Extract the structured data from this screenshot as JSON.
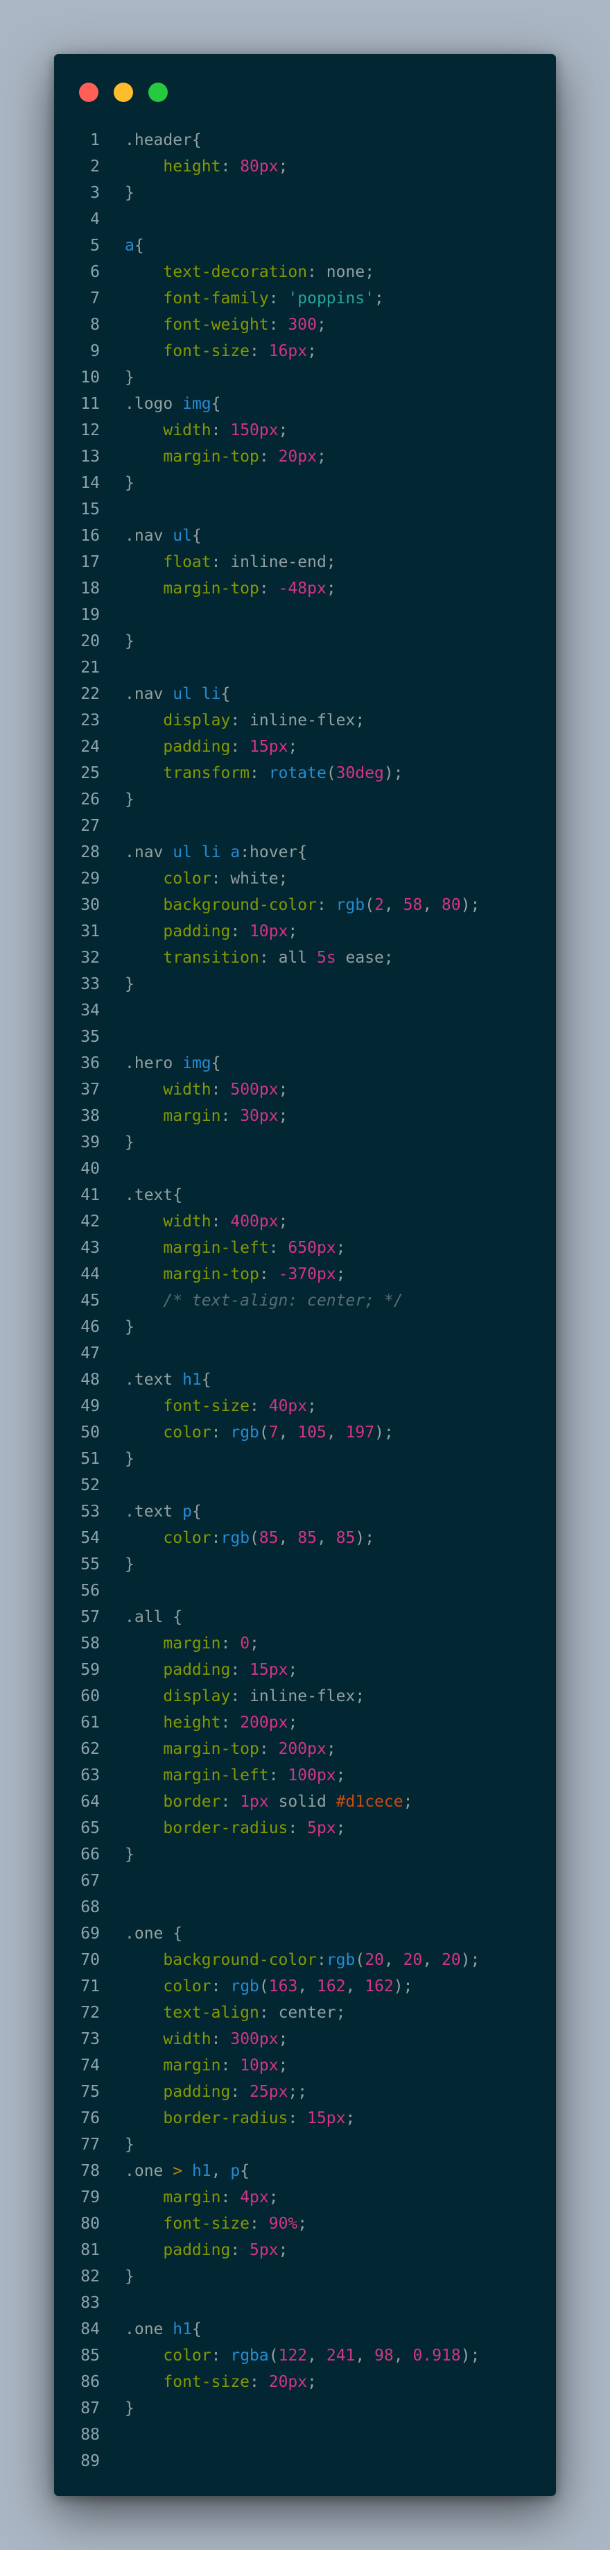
{
  "window": {
    "buttons": [
      "close",
      "minimize",
      "maximize"
    ]
  },
  "colors": {
    "page_background": "#aab6c3",
    "editor_background": "#022632",
    "close": "#ff5f56",
    "minimize": "#ffbd2e",
    "maximize": "#27c93f"
  },
  "lines": [
    [
      [
        "sel",
        ".header{"
      ]
    ],
    [
      [
        "plain",
        "    "
      ],
      [
        "prop",
        "height"
      ],
      [
        "plain",
        ": "
      ],
      [
        "num",
        "80px"
      ],
      [
        "plain",
        ";"
      ]
    ],
    [
      [
        "sel",
        "}"
      ]
    ],
    [],
    [
      [
        "tag",
        "a"
      ],
      [
        "sel",
        "{"
      ]
    ],
    [
      [
        "plain",
        "    "
      ],
      [
        "prop",
        "text-decoration"
      ],
      [
        "plain",
        ": none;"
      ]
    ],
    [
      [
        "plain",
        "    "
      ],
      [
        "prop",
        "font-family"
      ],
      [
        "plain",
        ": "
      ],
      [
        "str",
        "'poppins'"
      ],
      [
        "plain",
        ";"
      ]
    ],
    [
      [
        "plain",
        "    "
      ],
      [
        "prop",
        "font-weight"
      ],
      [
        "plain",
        ": "
      ],
      [
        "num",
        "300"
      ],
      [
        "plain",
        ";"
      ]
    ],
    [
      [
        "plain",
        "    "
      ],
      [
        "prop",
        "font-size"
      ],
      [
        "plain",
        ": "
      ],
      [
        "num",
        "16px"
      ],
      [
        "plain",
        ";"
      ]
    ],
    [
      [
        "sel",
        "}"
      ]
    ],
    [
      [
        "sel",
        ".logo "
      ],
      [
        "tag",
        "img"
      ],
      [
        "sel",
        "{"
      ]
    ],
    [
      [
        "plain",
        "    "
      ],
      [
        "prop",
        "width"
      ],
      [
        "plain",
        ": "
      ],
      [
        "num",
        "150px"
      ],
      [
        "plain",
        ";"
      ]
    ],
    [
      [
        "plain",
        "    "
      ],
      [
        "prop",
        "margin-top"
      ],
      [
        "plain",
        ": "
      ],
      [
        "num",
        "20px"
      ],
      [
        "plain",
        ";"
      ]
    ],
    [
      [
        "sel",
        "}"
      ]
    ],
    [],
    [
      [
        "sel",
        ".nav "
      ],
      [
        "tag",
        "ul"
      ],
      [
        "sel",
        "{"
      ]
    ],
    [
      [
        "plain",
        "    "
      ],
      [
        "prop",
        "float"
      ],
      [
        "plain",
        ": inline-end;"
      ]
    ],
    [
      [
        "plain",
        "    "
      ],
      [
        "prop",
        "margin-top"
      ],
      [
        "plain",
        ": "
      ],
      [
        "num",
        "-48px"
      ],
      [
        "plain",
        ";"
      ]
    ],
    [],
    [
      [
        "sel",
        "}"
      ]
    ],
    [],
    [
      [
        "sel",
        ".nav "
      ],
      [
        "tag",
        "ul li"
      ],
      [
        "sel",
        "{"
      ]
    ],
    [
      [
        "plain",
        "    "
      ],
      [
        "prop",
        "display"
      ],
      [
        "plain",
        ": inline-flex;"
      ]
    ],
    [
      [
        "plain",
        "    "
      ],
      [
        "prop",
        "padding"
      ],
      [
        "plain",
        ": "
      ],
      [
        "num",
        "15px"
      ],
      [
        "plain",
        ";"
      ]
    ],
    [
      [
        "plain",
        "    "
      ],
      [
        "prop",
        "transform"
      ],
      [
        "plain",
        ": "
      ],
      [
        "fn",
        "rotate"
      ],
      [
        "plain",
        "("
      ],
      [
        "num",
        "30deg"
      ],
      [
        "plain",
        ");"
      ]
    ],
    [
      [
        "sel",
        "}"
      ]
    ],
    [],
    [
      [
        "sel",
        ".nav "
      ],
      [
        "tag",
        "ul li a"
      ],
      [
        "sel",
        ":hover{"
      ]
    ],
    [
      [
        "plain",
        "    "
      ],
      [
        "prop",
        "color"
      ],
      [
        "plain",
        ": white;"
      ]
    ],
    [
      [
        "plain",
        "    "
      ],
      [
        "prop",
        "background-color"
      ],
      [
        "plain",
        ": "
      ],
      [
        "fn",
        "rgb"
      ],
      [
        "plain",
        "("
      ],
      [
        "num",
        "2"
      ],
      [
        "plain",
        ", "
      ],
      [
        "num",
        "58"
      ],
      [
        "plain",
        ", "
      ],
      [
        "num",
        "80"
      ],
      [
        "plain",
        ");"
      ]
    ],
    [
      [
        "plain",
        "    "
      ],
      [
        "prop",
        "padding"
      ],
      [
        "plain",
        ": "
      ],
      [
        "num",
        "10px"
      ],
      [
        "plain",
        ";"
      ]
    ],
    [
      [
        "plain",
        "    "
      ],
      [
        "prop",
        "transition"
      ],
      [
        "plain",
        ": all "
      ],
      [
        "num",
        "5s"
      ],
      [
        "plain",
        " ease;"
      ]
    ],
    [
      [
        "sel",
        "}"
      ]
    ],
    [],
    [],
    [
      [
        "sel",
        ".hero "
      ],
      [
        "tag",
        "img"
      ],
      [
        "sel",
        "{"
      ]
    ],
    [
      [
        "plain",
        "    "
      ],
      [
        "prop",
        "width"
      ],
      [
        "plain",
        ": "
      ],
      [
        "num",
        "500px"
      ],
      [
        "plain",
        ";"
      ]
    ],
    [
      [
        "plain",
        "    "
      ],
      [
        "prop",
        "margin"
      ],
      [
        "plain",
        ": "
      ],
      [
        "num",
        "30px"
      ],
      [
        "plain",
        ";"
      ]
    ],
    [
      [
        "sel",
        "}"
      ]
    ],
    [],
    [
      [
        "sel",
        ".text{"
      ]
    ],
    [
      [
        "plain",
        "    "
      ],
      [
        "prop",
        "width"
      ],
      [
        "plain",
        ": "
      ],
      [
        "num",
        "400px"
      ],
      [
        "plain",
        ";"
      ]
    ],
    [
      [
        "plain",
        "    "
      ],
      [
        "prop",
        "margin-left"
      ],
      [
        "plain",
        ": "
      ],
      [
        "num",
        "650px"
      ],
      [
        "plain",
        ";"
      ]
    ],
    [
      [
        "plain",
        "    "
      ],
      [
        "prop",
        "margin-top"
      ],
      [
        "plain",
        ": "
      ],
      [
        "num",
        "-370px"
      ],
      [
        "plain",
        ";"
      ]
    ],
    [
      [
        "plain",
        "    "
      ],
      [
        "cmt",
        "/* text-align: center; */"
      ]
    ],
    [
      [
        "sel",
        "}"
      ]
    ],
    [],
    [
      [
        "sel",
        ".text "
      ],
      [
        "tag",
        "h1"
      ],
      [
        "sel",
        "{"
      ]
    ],
    [
      [
        "plain",
        "    "
      ],
      [
        "prop",
        "font-size"
      ],
      [
        "plain",
        ": "
      ],
      [
        "num",
        "40px"
      ],
      [
        "plain",
        ";"
      ]
    ],
    [
      [
        "plain",
        "    "
      ],
      [
        "prop",
        "color"
      ],
      [
        "plain",
        ": "
      ],
      [
        "fn",
        "rgb"
      ],
      [
        "plain",
        "("
      ],
      [
        "num",
        "7"
      ],
      [
        "plain",
        ", "
      ],
      [
        "num",
        "105"
      ],
      [
        "plain",
        ", "
      ],
      [
        "num",
        "197"
      ],
      [
        "plain",
        ");"
      ]
    ],
    [
      [
        "sel",
        "}"
      ]
    ],
    [],
    [
      [
        "sel",
        ".text "
      ],
      [
        "tag",
        "p"
      ],
      [
        "sel",
        "{"
      ]
    ],
    [
      [
        "plain",
        "    "
      ],
      [
        "prop",
        "color"
      ],
      [
        "plain",
        ":"
      ],
      [
        "fn",
        "rgb"
      ],
      [
        "plain",
        "("
      ],
      [
        "num",
        "85"
      ],
      [
        "plain",
        ", "
      ],
      [
        "num",
        "85"
      ],
      [
        "plain",
        ", "
      ],
      [
        "num",
        "85"
      ],
      [
        "plain",
        ");"
      ]
    ],
    [
      [
        "sel",
        "}"
      ]
    ],
    [],
    [
      [
        "sel",
        ".all {"
      ]
    ],
    [
      [
        "plain",
        "    "
      ],
      [
        "prop",
        "margin"
      ],
      [
        "plain",
        ": "
      ],
      [
        "num",
        "0"
      ],
      [
        "plain",
        ";"
      ]
    ],
    [
      [
        "plain",
        "    "
      ],
      [
        "prop",
        "padding"
      ],
      [
        "plain",
        ": "
      ],
      [
        "num",
        "15px"
      ],
      [
        "plain",
        ";"
      ]
    ],
    [
      [
        "plain",
        "    "
      ],
      [
        "prop",
        "display"
      ],
      [
        "plain",
        ": inline-flex;"
      ]
    ],
    [
      [
        "plain",
        "    "
      ],
      [
        "prop",
        "height"
      ],
      [
        "plain",
        ": "
      ],
      [
        "num",
        "200px"
      ],
      [
        "plain",
        ";"
      ]
    ],
    [
      [
        "plain",
        "    "
      ],
      [
        "prop",
        "margin-top"
      ],
      [
        "plain",
        ": "
      ],
      [
        "num",
        "200px"
      ],
      [
        "plain",
        ";"
      ]
    ],
    [
      [
        "plain",
        "    "
      ],
      [
        "prop",
        "margin-left"
      ],
      [
        "plain",
        ": "
      ],
      [
        "num",
        "100px"
      ],
      [
        "plain",
        ";"
      ]
    ],
    [
      [
        "plain",
        "    "
      ],
      [
        "prop",
        "border"
      ],
      [
        "plain",
        ": "
      ],
      [
        "num",
        "1px"
      ],
      [
        "plain",
        " solid "
      ],
      [
        "hex",
        "#d1cece"
      ],
      [
        "plain",
        ";"
      ]
    ],
    [
      [
        "plain",
        "    "
      ],
      [
        "prop",
        "border-radius"
      ],
      [
        "plain",
        ": "
      ],
      [
        "num",
        "5px"
      ],
      [
        "plain",
        ";"
      ]
    ],
    [
      [
        "sel",
        "}"
      ]
    ],
    [],
    [],
    [
      [
        "sel",
        ".one {"
      ]
    ],
    [
      [
        "plain",
        "    "
      ],
      [
        "prop",
        "background-color"
      ],
      [
        "plain",
        ":"
      ],
      [
        "fn",
        "rgb"
      ],
      [
        "plain",
        "("
      ],
      [
        "num",
        "20"
      ],
      [
        "plain",
        ", "
      ],
      [
        "num",
        "20"
      ],
      [
        "plain",
        ", "
      ],
      [
        "num",
        "20"
      ],
      [
        "plain",
        ");"
      ]
    ],
    [
      [
        "plain",
        "    "
      ],
      [
        "prop",
        "color"
      ],
      [
        "plain",
        ": "
      ],
      [
        "fn",
        "rgb"
      ],
      [
        "plain",
        "("
      ],
      [
        "num",
        "163"
      ],
      [
        "plain",
        ", "
      ],
      [
        "num",
        "162"
      ],
      [
        "plain",
        ", "
      ],
      [
        "num",
        "162"
      ],
      [
        "plain",
        ");"
      ]
    ],
    [
      [
        "plain",
        "    "
      ],
      [
        "prop",
        "text-align"
      ],
      [
        "plain",
        ": center;"
      ]
    ],
    [
      [
        "plain",
        "    "
      ],
      [
        "prop",
        "width"
      ],
      [
        "plain",
        ": "
      ],
      [
        "num",
        "300px"
      ],
      [
        "plain",
        ";"
      ]
    ],
    [
      [
        "plain",
        "    "
      ],
      [
        "prop",
        "margin"
      ],
      [
        "plain",
        ": "
      ],
      [
        "num",
        "10px"
      ],
      [
        "plain",
        ";"
      ]
    ],
    [
      [
        "plain",
        "    "
      ],
      [
        "prop",
        "padding"
      ],
      [
        "plain",
        ": "
      ],
      [
        "num",
        "25px"
      ],
      [
        "plain",
        ";;"
      ]
    ],
    [
      [
        "plain",
        "    "
      ],
      [
        "prop",
        "border-radius"
      ],
      [
        "plain",
        ": "
      ],
      [
        "num",
        "15px"
      ],
      [
        "plain",
        ";"
      ]
    ],
    [
      [
        "sel",
        "}"
      ]
    ],
    [
      [
        "sel",
        ".one "
      ],
      [
        "kw",
        ">"
      ],
      [
        "plain",
        " "
      ],
      [
        "tag",
        "h1"
      ],
      [
        "plain",
        ", "
      ],
      [
        "tag",
        "p"
      ],
      [
        "sel",
        "{"
      ]
    ],
    [
      [
        "plain",
        "    "
      ],
      [
        "prop",
        "margin"
      ],
      [
        "plain",
        ": "
      ],
      [
        "num",
        "4px"
      ],
      [
        "plain",
        ";"
      ]
    ],
    [
      [
        "plain",
        "    "
      ],
      [
        "prop",
        "font-size"
      ],
      [
        "plain",
        ": "
      ],
      [
        "num",
        "90%"
      ],
      [
        "plain",
        ";"
      ]
    ],
    [
      [
        "plain",
        "    "
      ],
      [
        "prop",
        "padding"
      ],
      [
        "plain",
        ": "
      ],
      [
        "num",
        "5px"
      ],
      [
        "plain",
        ";"
      ]
    ],
    [
      [
        "sel",
        "}"
      ]
    ],
    [],
    [
      [
        "sel",
        ".one "
      ],
      [
        "tag",
        "h1"
      ],
      [
        "sel",
        "{"
      ]
    ],
    [
      [
        "plain",
        "    "
      ],
      [
        "prop",
        "color"
      ],
      [
        "plain",
        ": "
      ],
      [
        "fn",
        "rgba"
      ],
      [
        "plain",
        "("
      ],
      [
        "num",
        "122"
      ],
      [
        "plain",
        ", "
      ],
      [
        "num",
        "241"
      ],
      [
        "plain",
        ", "
      ],
      [
        "num",
        "98"
      ],
      [
        "plain",
        ", "
      ],
      [
        "num",
        "0.918"
      ],
      [
        "plain",
        ");"
      ]
    ],
    [
      [
        "plain",
        "    "
      ],
      [
        "prop",
        "font-size"
      ],
      [
        "plain",
        ": "
      ],
      [
        "num",
        "20px"
      ],
      [
        "plain",
        ";"
      ]
    ],
    [
      [
        "sel",
        "}"
      ]
    ],
    [],
    []
  ]
}
